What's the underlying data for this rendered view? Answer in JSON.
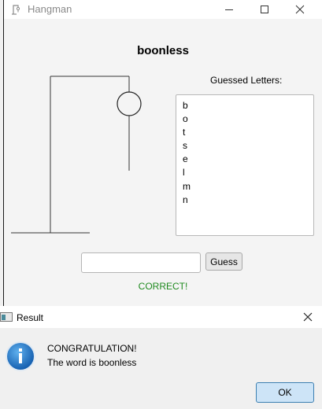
{
  "window": {
    "title": "Hangman"
  },
  "game": {
    "word": "boonless",
    "guessed_label": "Guessed Letters:",
    "guessed_letters": [
      "b",
      "o",
      "t",
      "s",
      "e",
      "l",
      "m",
      "n"
    ],
    "guess_input_value": "",
    "guess_button": "Guess",
    "status": "CORRECT!"
  },
  "dialog": {
    "title": "Result",
    "message_line1": "CONGRATULATION!",
    "message_line2": "The word is boonless",
    "ok_button": "OK"
  },
  "colors": {
    "status_text": "#1f8a1f",
    "info_icon": "#1e78c8",
    "ok_button_border": "#3c7fb1"
  }
}
